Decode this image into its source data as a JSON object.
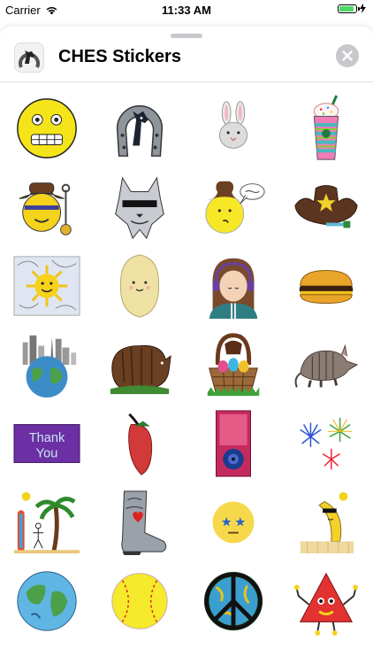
{
  "status_bar": {
    "carrier": "Carrier",
    "time": "11:33 AM",
    "battery_level": 0.9,
    "battery_color": "#4cd964"
  },
  "header": {
    "title": "CHES Stickers",
    "icon": "horse-logo-icon",
    "close_icon": "close-icon"
  },
  "stickers": [
    "grimace-emoji-sticker",
    "horseshoe-horse-sticker",
    "bunny-sticker",
    "frappuccino-sticker",
    "cowboy-emoji-sticker",
    "cool-wolf-sticker",
    "thinking-emoji-sticker",
    "cowboy-hat-sticker",
    "sun-sticker",
    "potato-sticker",
    "girl-headphones-sticker",
    "hamburger-sticker",
    "world-city-sticker",
    "bear-sticker",
    "easter-basket-sticker",
    "armadillo-sticker",
    "thank-you-sticker",
    "chili-pepper-sticker",
    "phone-sticker",
    "fireworks-sticker",
    "beach-palm-sticker",
    "cowboy-boot-sticker",
    "star-eyes-emoji-sticker",
    "banana-sticker",
    "earth-sticker",
    "softball-sticker",
    "peace-sign-sticker",
    "triangle-monster-sticker"
  ],
  "thank_you_text": {
    "line1": "Thank",
    "line2": "You"
  },
  "colors": {
    "accent": "#000000",
    "close_bg": "#c7c7cc",
    "grabber": "#c8c8cc"
  }
}
